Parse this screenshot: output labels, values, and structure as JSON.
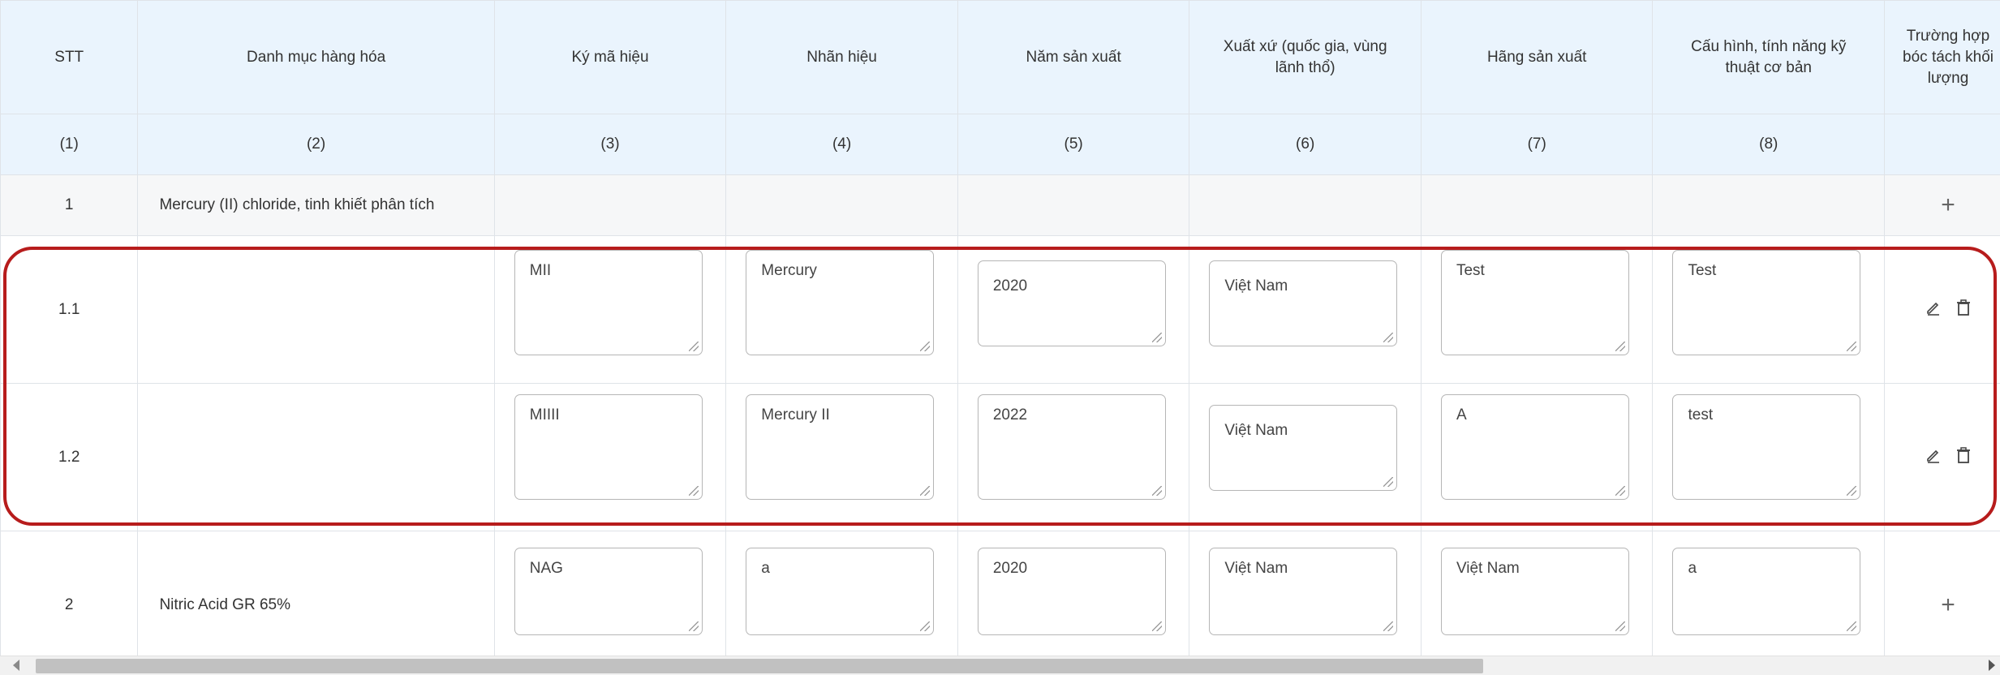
{
  "headers": [
    "STT",
    "Danh mục hàng hóa",
    "Ký mã hiệu",
    "Nhãn hiệu",
    "Năm sản xuất",
    "Xuất xứ (quốc gia, vùng lãnh thổ)",
    "Hãng sản xuất",
    "Cấu hình, tính năng kỹ thuật cơ bản",
    "Trường hợp bóc tách khối lượng"
  ],
  "col_numbers": [
    "(1)",
    "(2)",
    "(3)",
    "(4)",
    "(5)",
    "(6)",
    "(7)",
    "(8)",
    ""
  ],
  "group1": {
    "stt": "1",
    "name": "Mercury (II) chloride, tinh khiết phân tích",
    "action": "+"
  },
  "row11": {
    "stt": "1.1",
    "values": [
      "MII",
      "Mercury",
      "2020",
      "Việt Nam",
      "Test",
      "Test"
    ]
  },
  "row12": {
    "stt": "1.2",
    "values": [
      "MIIII",
      "Mercury II",
      "2022",
      "Việt Nam",
      "A",
      "test"
    ]
  },
  "group2": {
    "stt": "2",
    "name": "Nitric Acid GR 65%",
    "values": [
      "NAG",
      "a",
      "2020",
      "Việt Nam",
      "Việt Nam",
      "a"
    ],
    "action": "+"
  },
  "icons": {
    "edit": "edit-icon",
    "delete": "trash-icon"
  },
  "colors": {
    "header_bg": "#eaf4fd",
    "group_bg": "#f6f7f8",
    "highlight": "#b71c1c"
  }
}
